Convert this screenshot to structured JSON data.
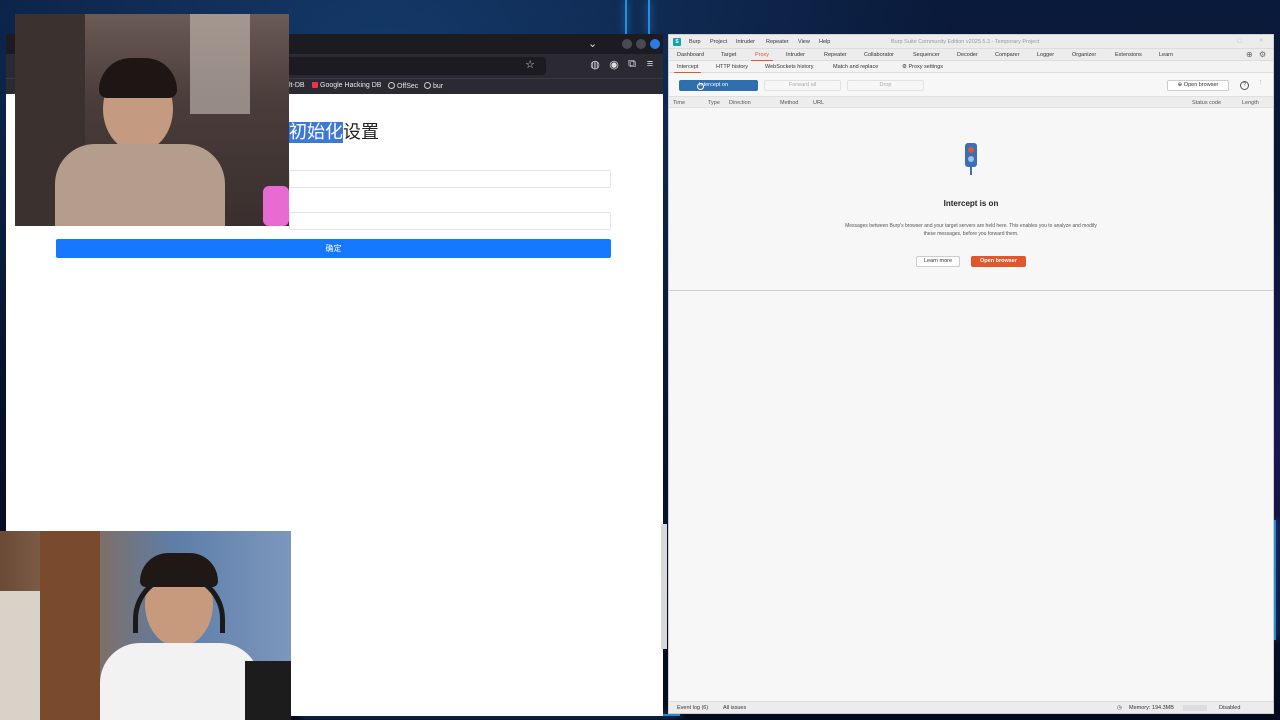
{
  "browser": {
    "bookmarks": [
      {
        "label": "lt-DB"
      },
      {
        "label": "Google Hacking DB"
      },
      {
        "label": "OffSec"
      },
      {
        "label": "bur"
      }
    ],
    "page": {
      "title_selected": "初始化",
      "title_rest": "设置",
      "confirm_button": "确定"
    }
  },
  "burp": {
    "title": "Burp Suite Community Edition v2025.5.3 - Temporary Project",
    "menu": [
      "Burp",
      "Project",
      "Intruder",
      "Repeater",
      "View",
      "Help"
    ],
    "tabs": [
      "Dashboard",
      "Target",
      "Proxy",
      "Intruder",
      "Repeater",
      "Collaborator",
      "Sequencer",
      "Decoder",
      "Comparer",
      "Logger",
      "Organizer",
      "Extensions",
      "Learn"
    ],
    "active_tab": "Proxy",
    "subtabs": [
      "Intercept",
      "HTTP history",
      "WebSockets history",
      "Match and replace"
    ],
    "proxy_settings": "Proxy settings",
    "intercept_button": "Intercept on",
    "forward_all": "Forward all",
    "drop": "Drop",
    "open_browser": "Open browser",
    "columns": [
      "Time",
      "Type",
      "Direction",
      "Method",
      "URL",
      "Status code",
      "Length"
    ],
    "empty_title": "Intercept is on",
    "empty_description": "Messages between Burp's browser and your target servers are held here. This enables you to analyze and modify these messages, before you forward them.",
    "learn_more": "Learn more",
    "open_browser_main": "Open browser",
    "status": {
      "event_log": "Event log (6)",
      "all_issues": "All issues",
      "memory": "Memory: 194.3MB",
      "disabled": "Disabled"
    }
  },
  "colors": {
    "burp_accent": "#e2562c",
    "intercept_blue": "#2f6fb0",
    "page_button": "#1677ff",
    "selection": "#3b78d8"
  }
}
